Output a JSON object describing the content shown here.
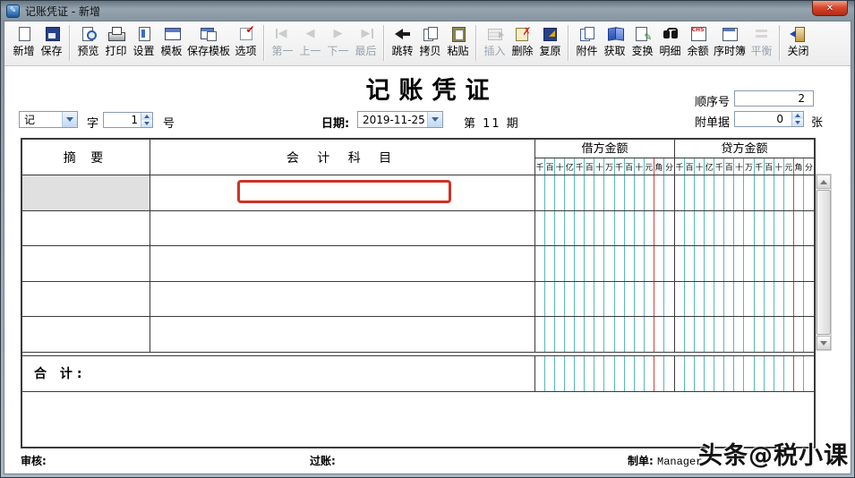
{
  "window": {
    "title": "记账凭证 - 新增",
    "close_glyph": "✕"
  },
  "toolbar": {
    "groups": [
      [
        {
          "name": "new",
          "label": "新增",
          "icon": "i-new",
          "enabled": true
        },
        {
          "name": "save",
          "label": "保存",
          "icon": "i-save",
          "enabled": true
        }
      ],
      [
        {
          "name": "preview",
          "label": "预览",
          "icon": "i-preview",
          "enabled": true
        },
        {
          "name": "print",
          "label": "打印",
          "icon": "i-print",
          "enabled": true
        },
        {
          "name": "setup",
          "label": "设置",
          "icon": "i-setup",
          "enabled": true
        },
        {
          "name": "template",
          "label": "模板",
          "icon": "i-template",
          "enabled": true
        },
        {
          "name": "save-template",
          "label": "保存模板",
          "icon": "i-savetpl",
          "enabled": true
        },
        {
          "name": "options",
          "label": "选项",
          "icon": "i-options",
          "enabled": true
        }
      ],
      [
        {
          "name": "first",
          "label": "第一",
          "icon": "i-first",
          "enabled": false
        },
        {
          "name": "previous",
          "label": "上一",
          "icon": "i-prev",
          "enabled": false
        },
        {
          "name": "next",
          "label": "下一",
          "icon": "i-next",
          "enabled": false
        },
        {
          "name": "last",
          "label": "最后",
          "icon": "i-last",
          "enabled": false
        }
      ],
      [
        {
          "name": "jump",
          "label": "跳转",
          "icon": "i-jump",
          "enabled": true
        },
        {
          "name": "copy",
          "label": "拷贝",
          "icon": "i-copy",
          "enabled": true
        },
        {
          "name": "paste",
          "label": "粘贴",
          "icon": "i-paste",
          "enabled": true
        }
      ],
      [
        {
          "name": "insert",
          "label": "插入",
          "icon": "i-insert",
          "enabled": false
        },
        {
          "name": "delete",
          "label": "删除",
          "icon": "i-delete",
          "enabled": true
        },
        {
          "name": "restore",
          "label": "复原",
          "icon": "i-restore",
          "enabled": true
        }
      ],
      [
        {
          "name": "attachment",
          "label": "附件",
          "icon": "i-attach",
          "enabled": true
        },
        {
          "name": "fetch",
          "label": "获取",
          "icon": "i-fetch",
          "enabled": true
        },
        {
          "name": "convert",
          "label": "变换",
          "icon": "i-convert",
          "enabled": true
        },
        {
          "name": "detail",
          "label": "明细",
          "icon": "i-detail",
          "enabled": true
        },
        {
          "name": "balance",
          "label": "余额",
          "icon": "i-balance",
          "enabled": true
        },
        {
          "name": "journal",
          "label": "序时簿",
          "icon": "i-journal",
          "enabled": true
        },
        {
          "name": "equalize",
          "label": "平衡",
          "icon": "i-equal",
          "enabled": false
        }
      ],
      [
        {
          "name": "close",
          "label": "关闭",
          "icon": "i-closedoor",
          "enabled": true
        }
      ]
    ]
  },
  "header": {
    "title": "记账凭证",
    "seq_label": "顺序号",
    "seq_value": "2",
    "attach_label": "附单据",
    "attach_value": "0",
    "attach_unit": "张",
    "voucher_word": "记",
    "word_suffix": "字",
    "number_value": "1",
    "number_suffix": "号",
    "date_label": "日期:",
    "date_value": "2019-11-25",
    "period_text": "第 11 期"
  },
  "table": {
    "summary_header": "摘  要",
    "account_header": "会 计 科 目",
    "debit_header": "借方金额",
    "credit_header": "贷方金额",
    "digit_headers": [
      "千",
      "百",
      "十",
      "亿",
      "千",
      "百",
      "十",
      "万",
      "千",
      "百",
      "十",
      "元",
      "角",
      "分"
    ],
    "body_row_count": 5,
    "total_label": "合  计:"
  },
  "footer": {
    "audit_label": "审核:",
    "post_label": "过账:",
    "prepare_label": "制单:",
    "preparer": "Manager",
    "watermark": "头条@税小课"
  },
  "colors": {
    "highlight_red": "#cf3225",
    "grid_teal": "#5ab8b4",
    "grid_red": "#cc4444",
    "selected_cell_gray": "#e0e0e0"
  }
}
